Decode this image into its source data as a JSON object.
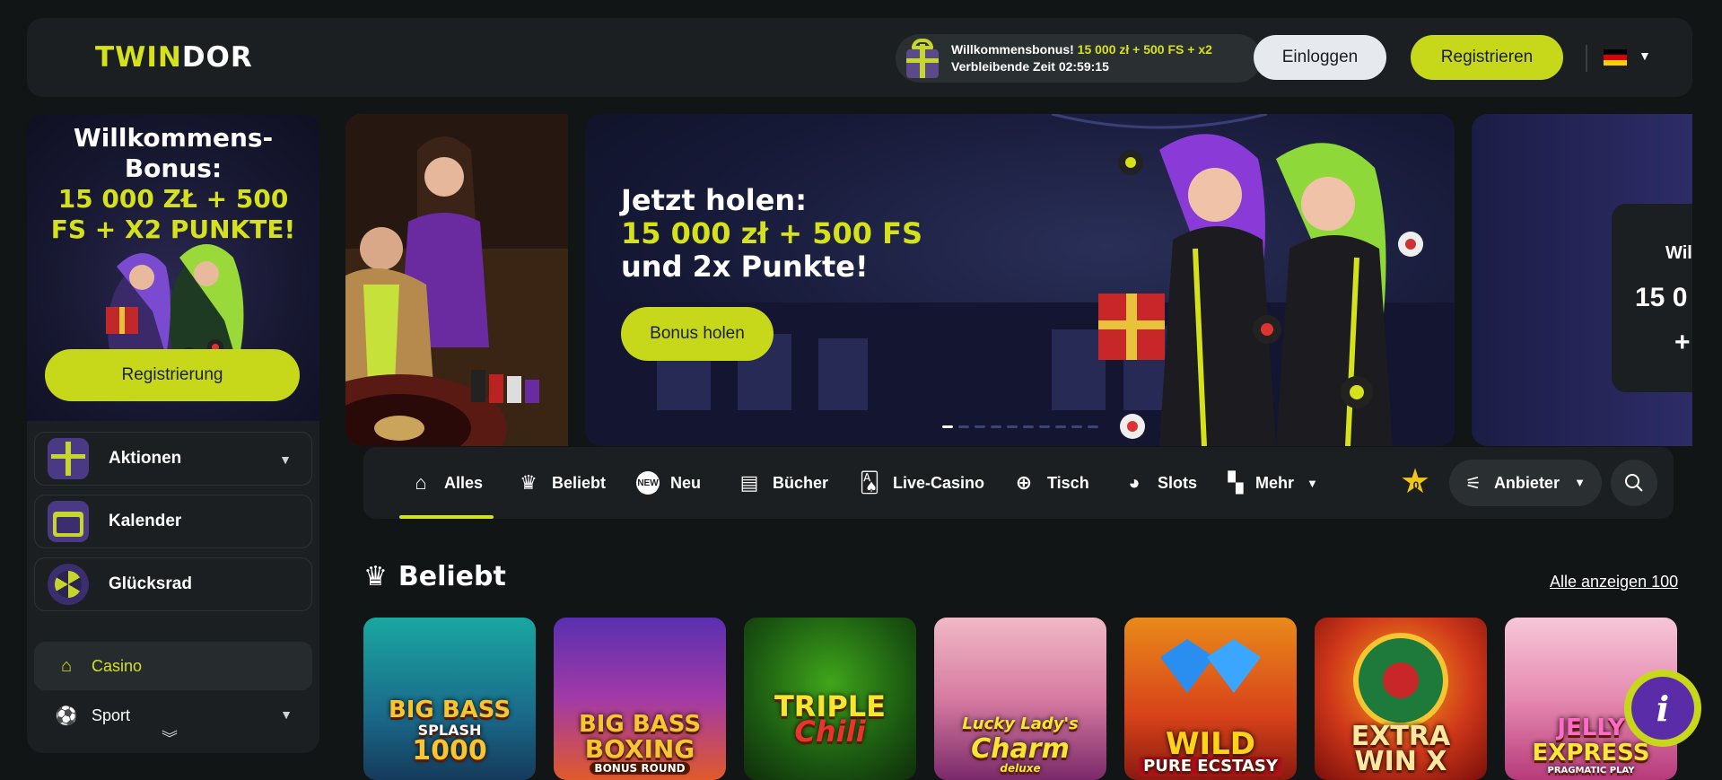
{
  "header": {
    "logo_part1": "TWIN",
    "logo_part2": "DOR",
    "bonus_line1_prefix": "Willkommensbonus! ",
    "bonus_line1_highlight": "15 000 zł + 500 FS + x2",
    "bonus_line2": "Verbleibende Zeit 02:59:15",
    "login_label": "Einloggen",
    "register_label": "Registrieren",
    "language": "DE"
  },
  "promo": {
    "title": "Willkommens-Bonus:",
    "subtitle": "15 000 ZŁ + 500 FS + X2 PUNKTE!",
    "button": "Registrierung"
  },
  "sidebar": {
    "items": [
      {
        "label": "Aktionen",
        "icon": "gift-box-icon"
      },
      {
        "label": "Kalender",
        "icon": "calendar-icon"
      },
      {
        "label": "Glücksrad",
        "icon": "wheel-icon"
      }
    ],
    "nav": [
      {
        "label": "Casino",
        "icon": "home-icon"
      },
      {
        "label": "Sport",
        "icon": "soccer-ball-icon"
      }
    ]
  },
  "banner": {
    "line1": "Jetzt holen:",
    "line2": "15 000 zł + 500 FS",
    "line3": "und 2x Punkte!",
    "button": "Bonus holen",
    "next_peek_line1": "Wil",
    "next_peek_line2": "15 0",
    "next_peek_line3": "+"
  },
  "categories": [
    {
      "label": "Alles",
      "icon": "home-icon"
    },
    {
      "label": "Beliebt",
      "icon": "crown-icon"
    },
    {
      "label": "Neu",
      "icon": "new-badge-icon"
    },
    {
      "label": "Bücher",
      "icon": "books-icon"
    },
    {
      "label": "Live-Casino",
      "icon": "cards-icon"
    },
    {
      "label": "Tisch",
      "icon": "chip-icon"
    },
    {
      "label": "Slots",
      "icon": "cherry-icon"
    },
    {
      "label": "Mehr",
      "icon": "more-icon"
    }
  ],
  "favorites_count": "0",
  "providers_label": "Anbieter",
  "section": {
    "title": "Beliebt",
    "see_all": "Alle anzeigen 100"
  },
  "games": [
    {
      "line1": "BIG BASS",
      "line2": "SPLASH",
      "line3": "1000"
    },
    {
      "line1": "BIG BASS",
      "line2": "BOXING",
      "line3": "BONUS ROUND"
    },
    {
      "line1": "TRIPLE",
      "line2": "Chili",
      "line3": ""
    },
    {
      "line1": "Lucky Lady's",
      "line2": "Charm",
      "line3": "deluxe"
    },
    {
      "line1": "WILD",
      "line2": "PURE ECSTASY",
      "line3": ""
    },
    {
      "line1": "EXTRA",
      "line2": "WIN X",
      "line3": ""
    },
    {
      "line1": "JELLY",
      "line2": "EXPRESS",
      "line3": "PRAGMATIC PLAY"
    }
  ],
  "colors": {
    "accent": "#d4e11b",
    "background": "#121516",
    "panel": "#1b1f21"
  }
}
